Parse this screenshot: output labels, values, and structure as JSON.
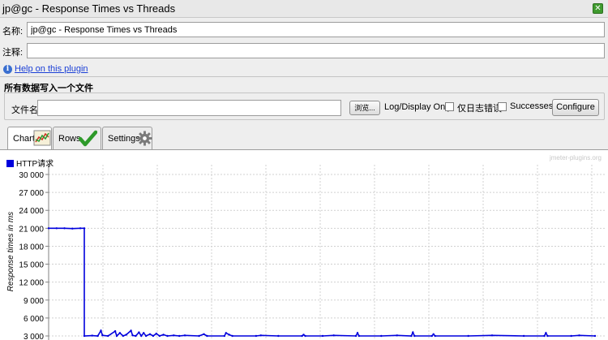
{
  "window": {
    "title": "jp@gc - Response Times vs Threads"
  },
  "name_field": {
    "label": "名称:",
    "value": "jp@gc - Response Times vs Threads"
  },
  "comment_field": {
    "label": "注释:",
    "value": ""
  },
  "help": {
    "link_text": "Help on this plugin"
  },
  "file_section": {
    "title": "所有数据写入一个文件",
    "file_label": "文件名",
    "file_value": "",
    "browse_label": "浏览...",
    "log_display_label": "Log/Display Only:",
    "errors_only_label": "仅日志错误",
    "successes_label": "Successes",
    "configure_label": "Configure"
  },
  "tabs": [
    {
      "label": "Chart",
      "icon": "chart-icon",
      "active": true
    },
    {
      "label": "Rows",
      "icon": "checkmark-icon",
      "active": false
    },
    {
      "label": "Settings",
      "icon": "gear-icon",
      "active": false
    }
  ],
  "watermark": "jmeter-plugins.org",
  "chart_data": {
    "type": "line",
    "ylabel": "Response times in ms",
    "xlabel": "",
    "ylim": [
      0,
      30000
    ],
    "yticks": [
      "30 000",
      "27 000",
      "24 000",
      "21 000",
      "18 000",
      "15 000",
      "12 000",
      "9 000",
      "6 000",
      "3 000"
    ],
    "ytick_values": [
      30000,
      27000,
      24000,
      21000,
      18000,
      15000,
      12000,
      9000,
      6000,
      3000
    ],
    "grid": true,
    "legend_position": "top-left",
    "series": [
      {
        "name": "HTTP请求",
        "color": "#0000dd",
        "points": [
          [
            0,
            21000
          ],
          [
            10,
            21000
          ],
          [
            20,
            21000
          ],
          [
            30,
            20950
          ],
          [
            40,
            21000
          ],
          [
            45,
            21000
          ],
          [
            45,
            3000
          ],
          [
            55,
            3050
          ],
          [
            62,
            3000
          ],
          [
            66,
            3900
          ],
          [
            68,
            3100
          ],
          [
            75,
            3000
          ],
          [
            84,
            3800
          ],
          [
            86,
            3000
          ],
          [
            90,
            3500
          ],
          [
            94,
            3000
          ],
          [
            98,
            3200
          ],
          [
            104,
            3900
          ],
          [
            106,
            3100
          ],
          [
            110,
            3000
          ],
          [
            114,
            3600
          ],
          [
            117,
            3000
          ],
          [
            120,
            3500
          ],
          [
            123,
            3000
          ],
          [
            128,
            3300
          ],
          [
            132,
            3000
          ],
          [
            136,
            3400
          ],
          [
            140,
            3000
          ],
          [
            145,
            3200
          ],
          [
            150,
            3000
          ],
          [
            158,
            3100
          ],
          [
            165,
            3000
          ],
          [
            172,
            3100
          ],
          [
            190,
            3000
          ],
          [
            196,
            3300
          ],
          [
            200,
            3000
          ],
          [
            222,
            3000
          ],
          [
            224,
            3500
          ],
          [
            228,
            3200
          ],
          [
            232,
            3000
          ],
          [
            262,
            3000
          ],
          [
            268,
            3100
          ],
          [
            290,
            3000
          ],
          [
            320,
            3000
          ],
          [
            322,
            3200
          ],
          [
            324,
            3000
          ],
          [
            346,
            3000
          ],
          [
            360,
            3100
          ],
          [
            388,
            3000
          ],
          [
            390,
            3500
          ],
          [
            392,
            3000
          ],
          [
            420,
            3000
          ],
          [
            440,
            3100
          ],
          [
            458,
            3000
          ],
          [
            460,
            3600
          ],
          [
            462,
            3000
          ],
          [
            484,
            3000
          ],
          [
            486,
            3300
          ],
          [
            488,
            3000
          ],
          [
            530,
            3000
          ],
          [
            560,
            3100
          ],
          [
            600,
            3000
          ],
          [
            626,
            3000
          ],
          [
            628,
            3500
          ],
          [
            630,
            3000
          ],
          [
            660,
            3000
          ],
          [
            670,
            3100
          ],
          [
            690,
            3000
          ]
        ]
      }
    ]
  }
}
